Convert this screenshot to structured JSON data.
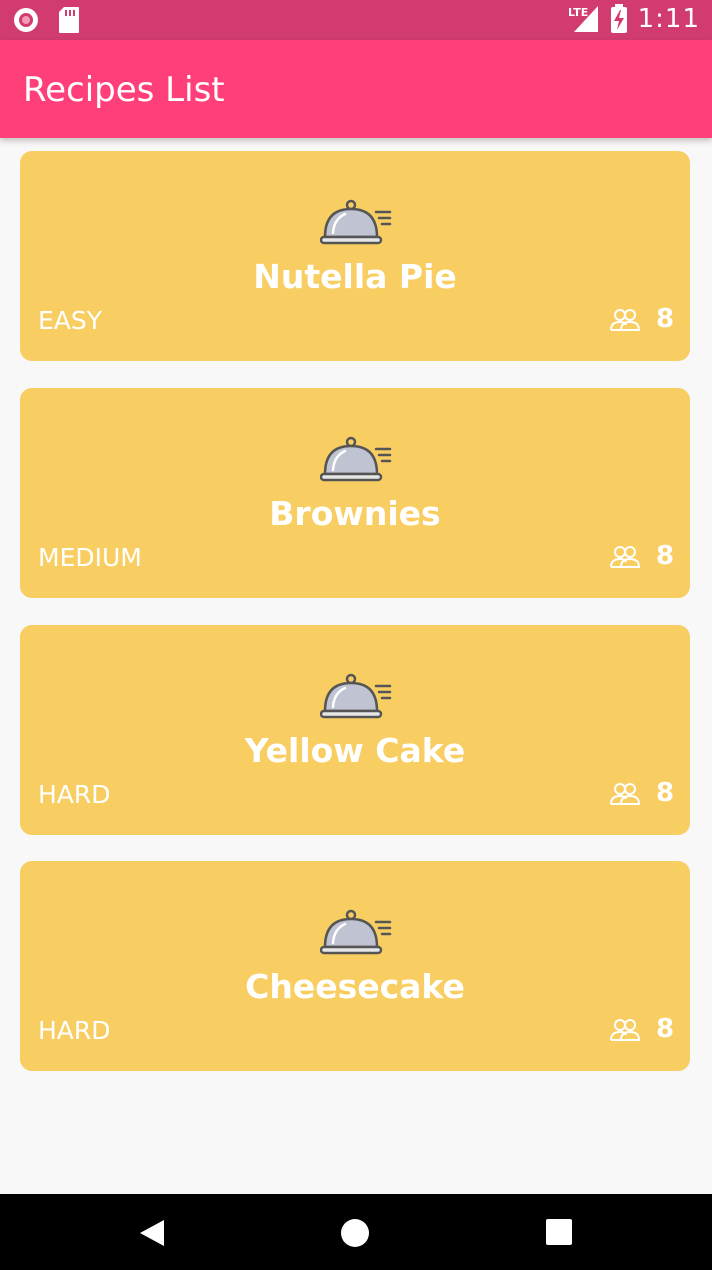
{
  "status_bar": {
    "network": "LTE",
    "time": "1:11",
    "icons": [
      "record-icon",
      "sd-card-icon",
      "signal-icon",
      "battery-charging-icon"
    ]
  },
  "app_bar": {
    "title": "Recipes List"
  },
  "recipes": [
    {
      "name": "Nutella Pie",
      "difficulty": "EASY",
      "servings": "8"
    },
    {
      "name": "Brownies",
      "difficulty": "MEDIUM",
      "servings": "8"
    },
    {
      "name": "Yellow Cake",
      "difficulty": "HARD",
      "servings": "8"
    },
    {
      "name": "Cheesecake",
      "difficulty": "HARD",
      "servings": "8"
    }
  ],
  "colors": {
    "status_bar": "#d23b70",
    "app_bar": "#fe3f7a",
    "card": "#f8ce63",
    "background": "#f8f8f8"
  },
  "nav_bar": {
    "icons": [
      "back-icon",
      "home-icon",
      "recents-icon"
    ]
  }
}
